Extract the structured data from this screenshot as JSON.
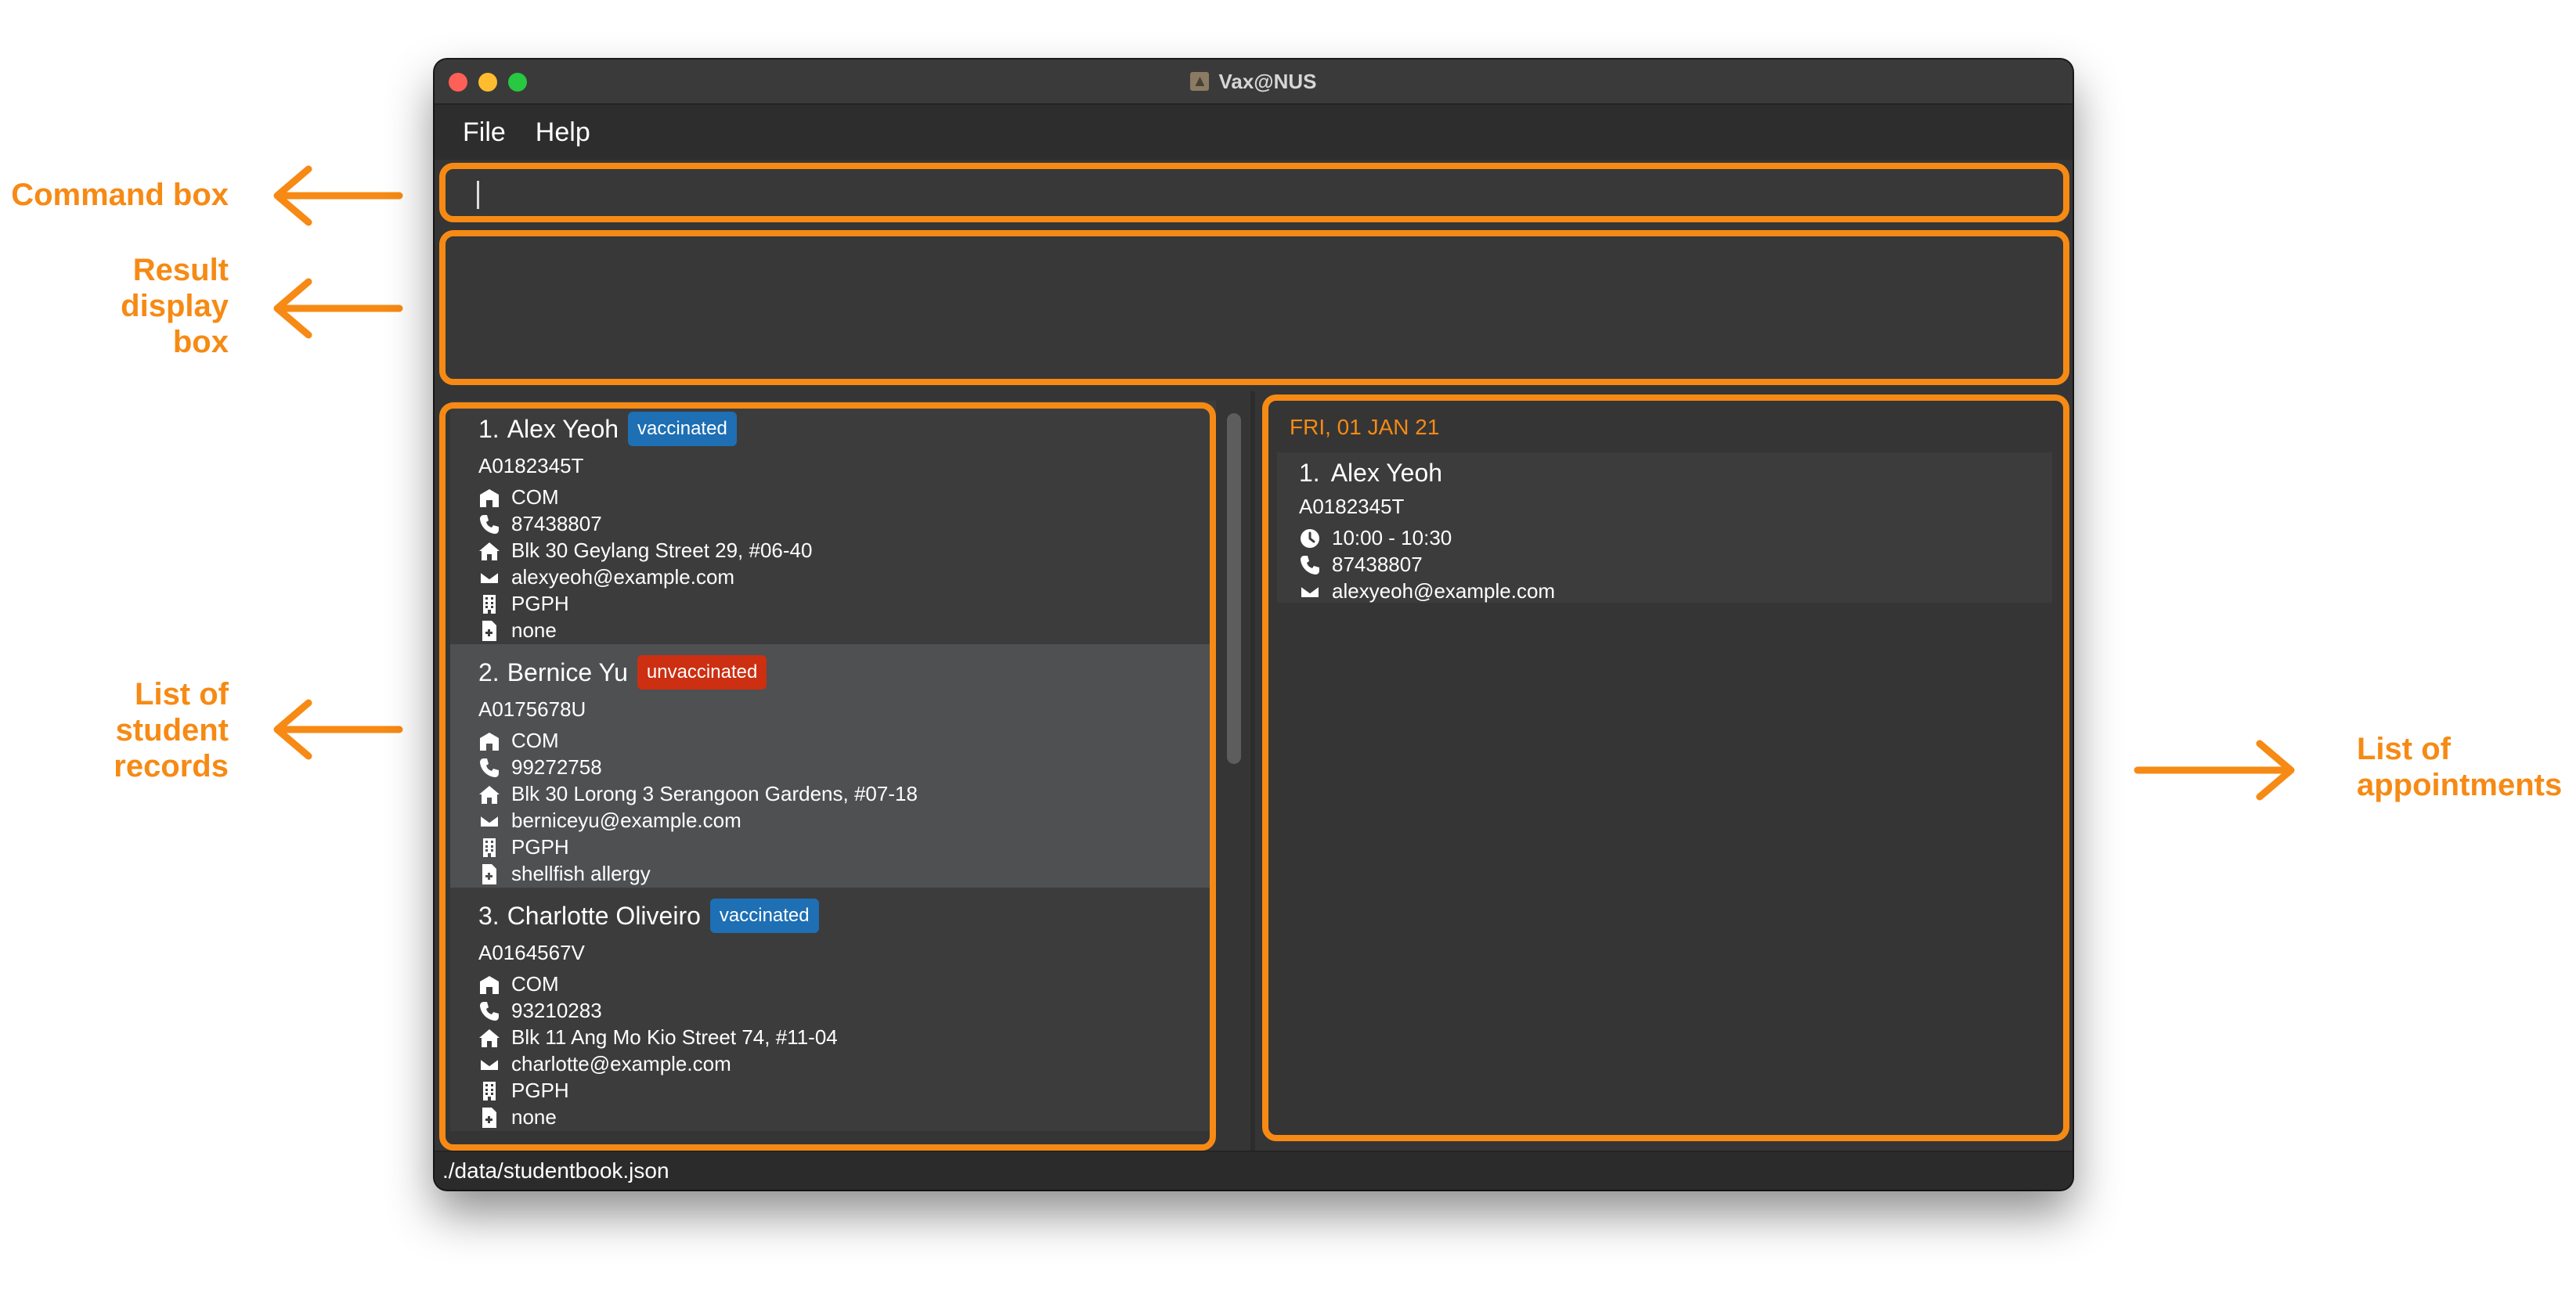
{
  "window": {
    "title": "Vax@NUS"
  },
  "menu": {
    "items": [
      "File",
      "Help"
    ]
  },
  "command": {
    "value": "",
    "placeholder": ""
  },
  "result": {
    "text": ""
  },
  "students": [
    {
      "index": "1.",
      "name": "Alex Yeoh",
      "status": "vaccinated",
      "status_color": "#1e6fb4",
      "matric": "A0182345T",
      "faculty": "COM",
      "phone": "87438807",
      "address": "Blk 30 Geylang Street 29, #06-40",
      "email": "alexyeoh@example.com",
      "residence": "PGPH",
      "medical": "none"
    },
    {
      "index": "2.",
      "name": "Bernice Yu",
      "status": "unvaccinated",
      "status_color": "#cc2f12",
      "matric": "A0175678U",
      "faculty": "COM",
      "phone": "99272758",
      "address": "Blk 30 Lorong 3 Serangoon Gardens, #07-18",
      "email": "berniceyu@example.com",
      "residence": "PGPH",
      "medical": "shellfish allergy"
    },
    {
      "index": "3.",
      "name": "Charlotte Oliveiro",
      "status": "vaccinated",
      "status_color": "#1e6fb4",
      "matric": "A0164567V",
      "faculty": "COM",
      "phone": "93210283",
      "address": "Blk 11 Ang Mo Kio Street 74, #11-04",
      "email": "charlotte@example.com",
      "residence": "PGPH",
      "medical": "none"
    }
  ],
  "appointments": {
    "date": "FRI, 01 JAN 21",
    "items": [
      {
        "index": "1.",
        "name": "Alex Yeoh",
        "matric": "A0182345T",
        "time": "10:00 - 10:30",
        "phone": "87438807",
        "email": "alexyeoh@example.com"
      }
    ]
  },
  "status_bar": {
    "path": "./data/studentbook.json"
  },
  "annotations": {
    "command_box": "Command box",
    "result_display": [
      "Result",
      "display",
      "box"
    ],
    "student_list": [
      "List of",
      "student",
      "records"
    ],
    "appointment_list": [
      "List of",
      "appointments"
    ]
  },
  "colors": {
    "accent": "#f68a14",
    "vaccinated": "#1e6fb4",
    "unvaccinated": "#cc2f12"
  },
  "icons": [
    "faculty-icon",
    "phone-icon",
    "home-icon",
    "email-icon",
    "building-icon",
    "medical-file-icon",
    "clock-icon"
  ]
}
